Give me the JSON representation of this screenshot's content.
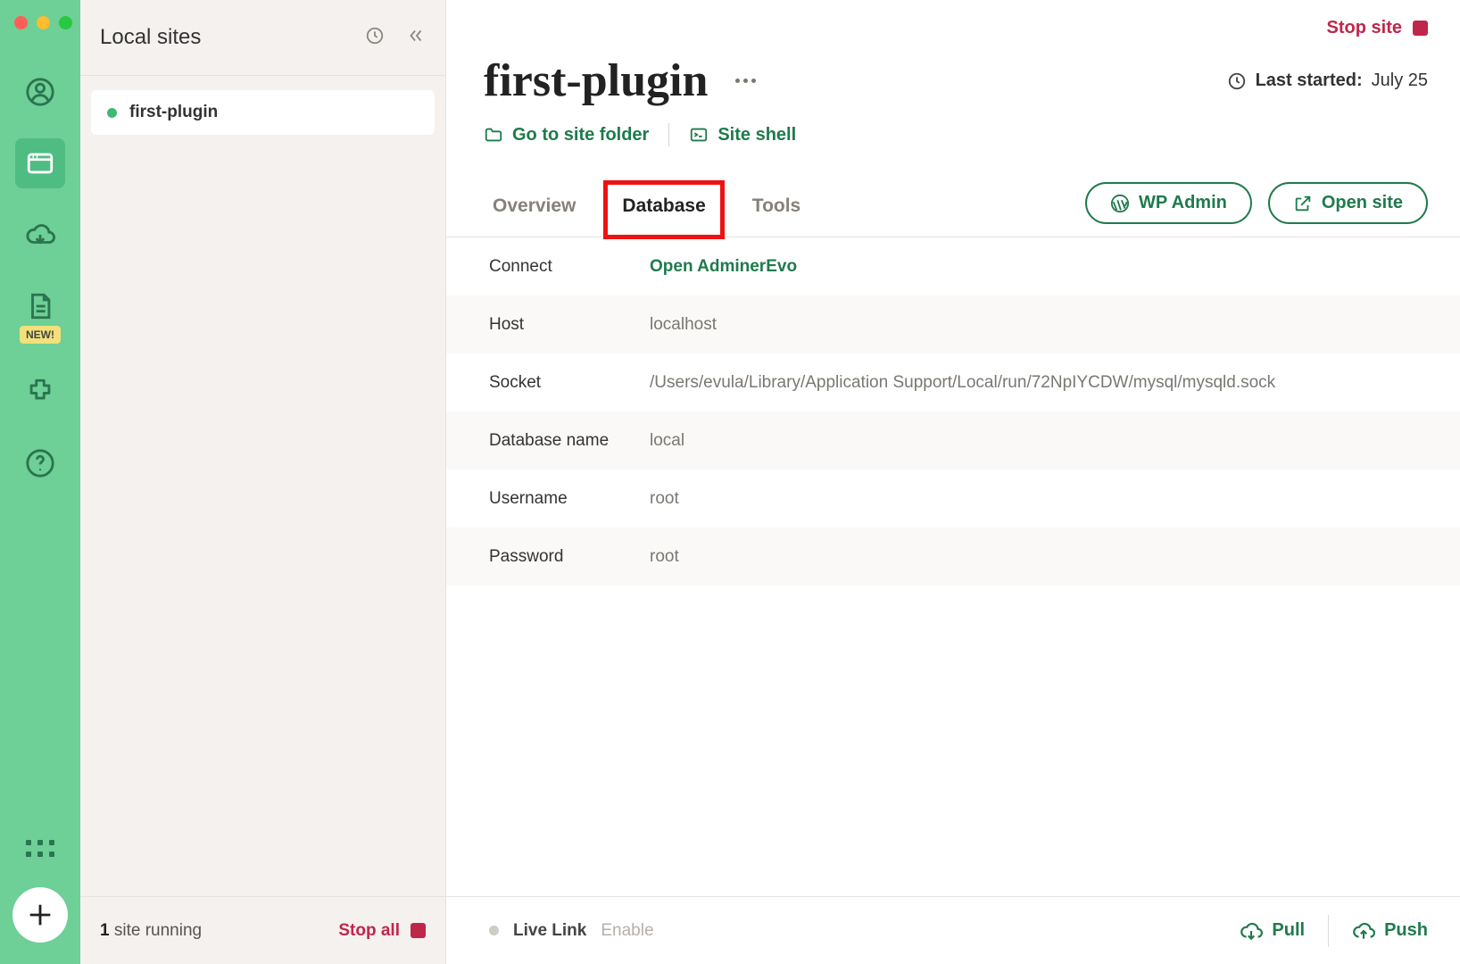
{
  "rail": {
    "new_badge": "NEW!"
  },
  "sidebar": {
    "title": "Local sites",
    "items": [
      {
        "name": "first-plugin",
        "status": "running"
      }
    ],
    "footer": {
      "count": "1",
      "running_suffix": " site running",
      "stop_all": "Stop all"
    }
  },
  "main": {
    "stop_site": "Stop site",
    "title": "first-plugin",
    "last_started_label": "Last started:",
    "last_started_value": "July 25",
    "links": {
      "folder": "Go to site folder",
      "shell": "Site shell"
    },
    "tabs": {
      "overview": "Overview",
      "database": "Database",
      "tools": "Tools"
    },
    "actions": {
      "wp_admin": "WP Admin",
      "open_site": "Open site"
    },
    "details": [
      {
        "key": "Connect",
        "value": "Open AdminerEvo",
        "link": true
      },
      {
        "key": "Host",
        "value": "localhost"
      },
      {
        "key": "Socket",
        "value": "/Users/evula/Library/Application Support/Local/run/72NpIYCDW/mysql/mysqld.sock"
      },
      {
        "key": "Database name",
        "value": "local"
      },
      {
        "key": "Username",
        "value": "root"
      },
      {
        "key": "Password",
        "value": "root"
      }
    ],
    "footer": {
      "live_link": "Live Link",
      "enable": "Enable",
      "pull": "Pull",
      "push": "Push"
    }
  }
}
